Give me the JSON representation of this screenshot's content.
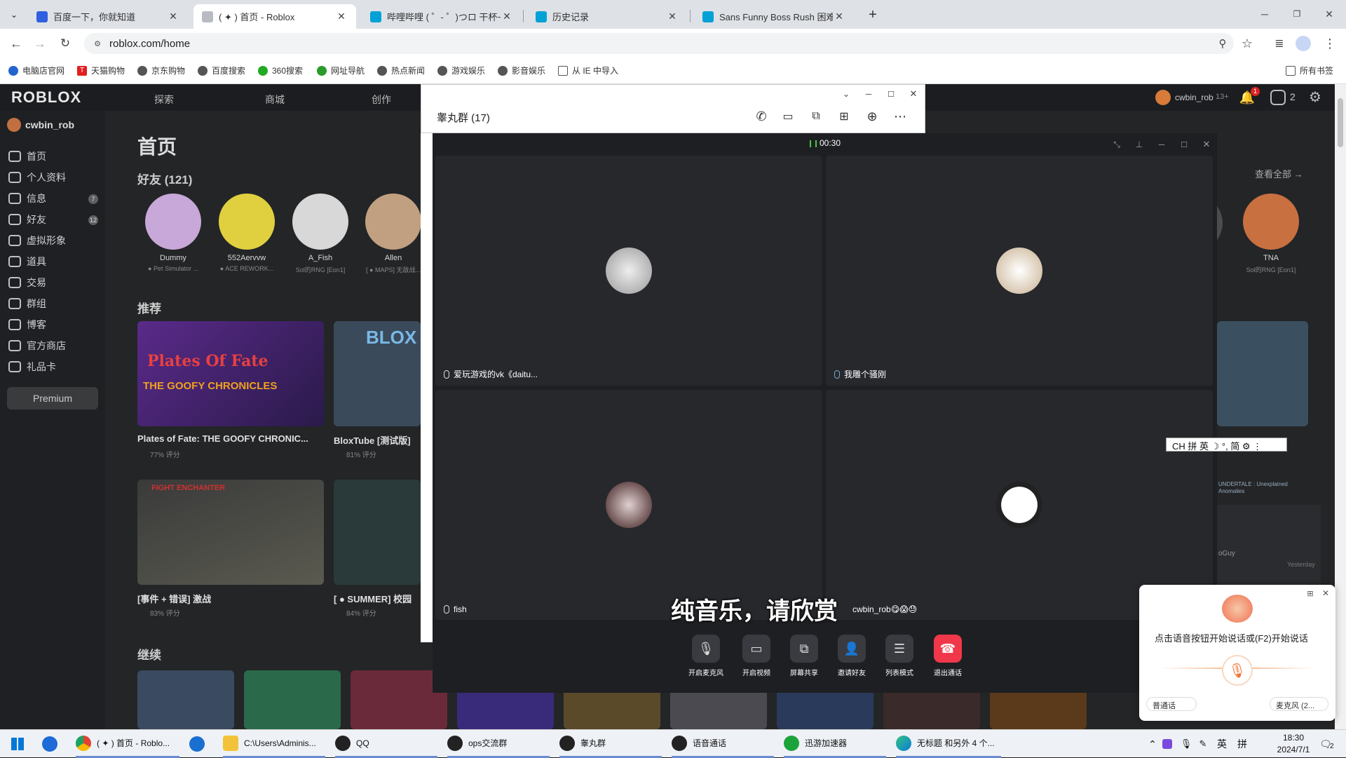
{
  "browser": {
    "tabs": [
      {
        "title": "百度一下，你就知道",
        "color": "#3060e0"
      },
      {
        "title": "( ✦ ) 首页 - Roblox",
        "color": "#999999"
      },
      {
        "title": "哔哩哔哩 ( ゜- ゜)つロ 干杯~-bili",
        "color": "#00a1d6"
      },
      {
        "title": "历史记录",
        "color": "#00a1d6"
      },
      {
        "title": "Sans Funny Boss Rush 困难模",
        "color": "#00a1d6"
      }
    ],
    "new_tab": "+",
    "url": "roblox.com/home",
    "bookmarks": [
      {
        "label": "电脑店官网",
        "color": "#2266cc"
      },
      {
        "label": "天猫购物",
        "color": "#e02020"
      },
      {
        "label": "京东购物",
        "color": "#555555"
      },
      {
        "label": "百度搜索",
        "color": "#555555"
      },
      {
        "label": "360搜索",
        "color": "#22aa22"
      },
      {
        "label": "网址导航",
        "color": "#2a9a2a"
      },
      {
        "label": "热点新闻",
        "color": "#555555"
      },
      {
        "label": "游戏娱乐",
        "color": "#555555"
      },
      {
        "label": "影音娱乐",
        "color": "#555555"
      },
      {
        "label": "从 IE 中导入",
        "color": "#555555"
      }
    ],
    "all_bookmarks": "所有书签"
  },
  "roblox": {
    "logo": "ROBLOX",
    "nav": [
      "探索",
      "商城",
      "创作"
    ],
    "username": "cwbin_rob",
    "age": "13+",
    "robux": "2",
    "notif_count": "1",
    "sidebar": [
      {
        "label": "首页",
        "badge": ""
      },
      {
        "label": "个人资料",
        "badge": ""
      },
      {
        "label": "信息",
        "badge": "7"
      },
      {
        "label": "好友",
        "badge": "12"
      },
      {
        "label": "虚拟形象",
        "badge": ""
      },
      {
        "label": "道具",
        "badge": ""
      },
      {
        "label": "交易",
        "badge": ""
      },
      {
        "label": "群组",
        "badge": ""
      },
      {
        "label": "博客",
        "badge": ""
      },
      {
        "label": "官方商店",
        "badge": ""
      },
      {
        "label": "礼品卡",
        "badge": ""
      }
    ],
    "premium": "Premium",
    "page_title": "首页",
    "friends_title": "好友 (121)",
    "see_all": "查看全部 →",
    "friends": [
      {
        "name": "Dummy",
        "status": "● Pet Simulator ...",
        "color": "#c8a8d8"
      },
      {
        "name": "552Aervvw",
        "status": "● ACE REWORK...",
        "color": "#e0d040"
      },
      {
        "name": "A_Fish",
        "status": "Sol的RNG [Eon1]",
        "color": "#d8d8d8"
      },
      {
        "name": "Allen",
        "status": "[ ● MAPS] 无敌战...",
        "color": "#c0a080"
      },
      {
        "name": "TNA",
        "status": "Sol的RNG [Eon1]",
        "color": "#c87040"
      }
    ],
    "recommended_title": "推荐",
    "games": [
      {
        "title": "Plates of Fate: THE GOOFY CHRONIC...",
        "rating": "77% 评分",
        "banner": "Plates Of Fate",
        "sub": "THE GOOFY CHRONICLES"
      },
      {
        "title": "BloxTube [测试版]",
        "rating": "81% 评分",
        "banner": "BLOX",
        "sub": ""
      },
      {
        "title": "[事件 + 错误] 激战",
        "rating": "83% 评分",
        "banner": "FIGHT ENCHANTER",
        "sub": ""
      },
      {
        "title": "[ ● SUMMER] 校园",
        "rating": "84% 评分",
        "banner": "",
        "sub": ""
      }
    ],
    "continue_title": "继续",
    "right_partial": {
      "label": "UNDERTALE : Unexplained Anomalies",
      "chat_user": "oGuy",
      "chat_time": "Yesterday"
    }
  },
  "qq_group": {
    "title": "睾丸群 (17)"
  },
  "call": {
    "timer": "00:30",
    "participants": [
      {
        "name": "爱玩游戏的vk《daitu...",
        "color": "#cfcfcf"
      },
      {
        "name": "我雕个骚刚",
        "color": "#e8e8e8"
      },
      {
        "name": "fish",
        "color": "#7a2a2a"
      },
      {
        "name": "cwbin_rob😋😱😓",
        "color": "#ffffff"
      }
    ],
    "controls": [
      {
        "label": "开启麦克风",
        "icon": "🎙"
      },
      {
        "label": "开启视频",
        "icon": "▭"
      },
      {
        "label": "屏幕共享",
        "icon": "⧉"
      },
      {
        "label": "邀请好友",
        "icon": "👤"
      },
      {
        "label": "列表模式",
        "icon": "☰"
      },
      {
        "label": "退出通话",
        "icon": "☎"
      }
    ],
    "subtitle": "纯音乐，请欣赏"
  },
  "ime_toolbar": "CH 拼 英 ☽ °, 简 ⚙ ⋮",
  "voice_input": {
    "prompt": "点击语音按钮开始说话或(F2)开始说话",
    "language": "普通话",
    "mic": "麦克风 (2..."
  },
  "taskbar": {
    "items": [
      {
        "label": "( ✦ ) 首页 - Roblo...",
        "color": "#e34133",
        "open": true
      },
      {
        "label": "",
        "color": "#1a6fd0",
        "open": false
      },
      {
        "label": "C:\\Users\\Adminis...",
        "color": "#f2c33a",
        "open": true
      },
      {
        "label": "QQ",
        "color": "#222222",
        "open": true
      },
      {
        "label": "ops交流群",
        "color": "#222222",
        "open": true
      },
      {
        "label": "睾丸群",
        "color": "#222222",
        "open": true
      },
      {
        "label": "语音通话",
        "color": "#222222",
        "open": true
      },
      {
        "label": "迅游加速器",
        "color": "#1ca33a",
        "open": true
      },
      {
        "label": "无标题 和另外 4 个...",
        "color": "#0c7bd8",
        "open": true
      }
    ],
    "tray_lang": "英",
    "tray_ime": "拼",
    "time": "18:30",
    "date": "2024/7/1",
    "notif_count": "2"
  }
}
